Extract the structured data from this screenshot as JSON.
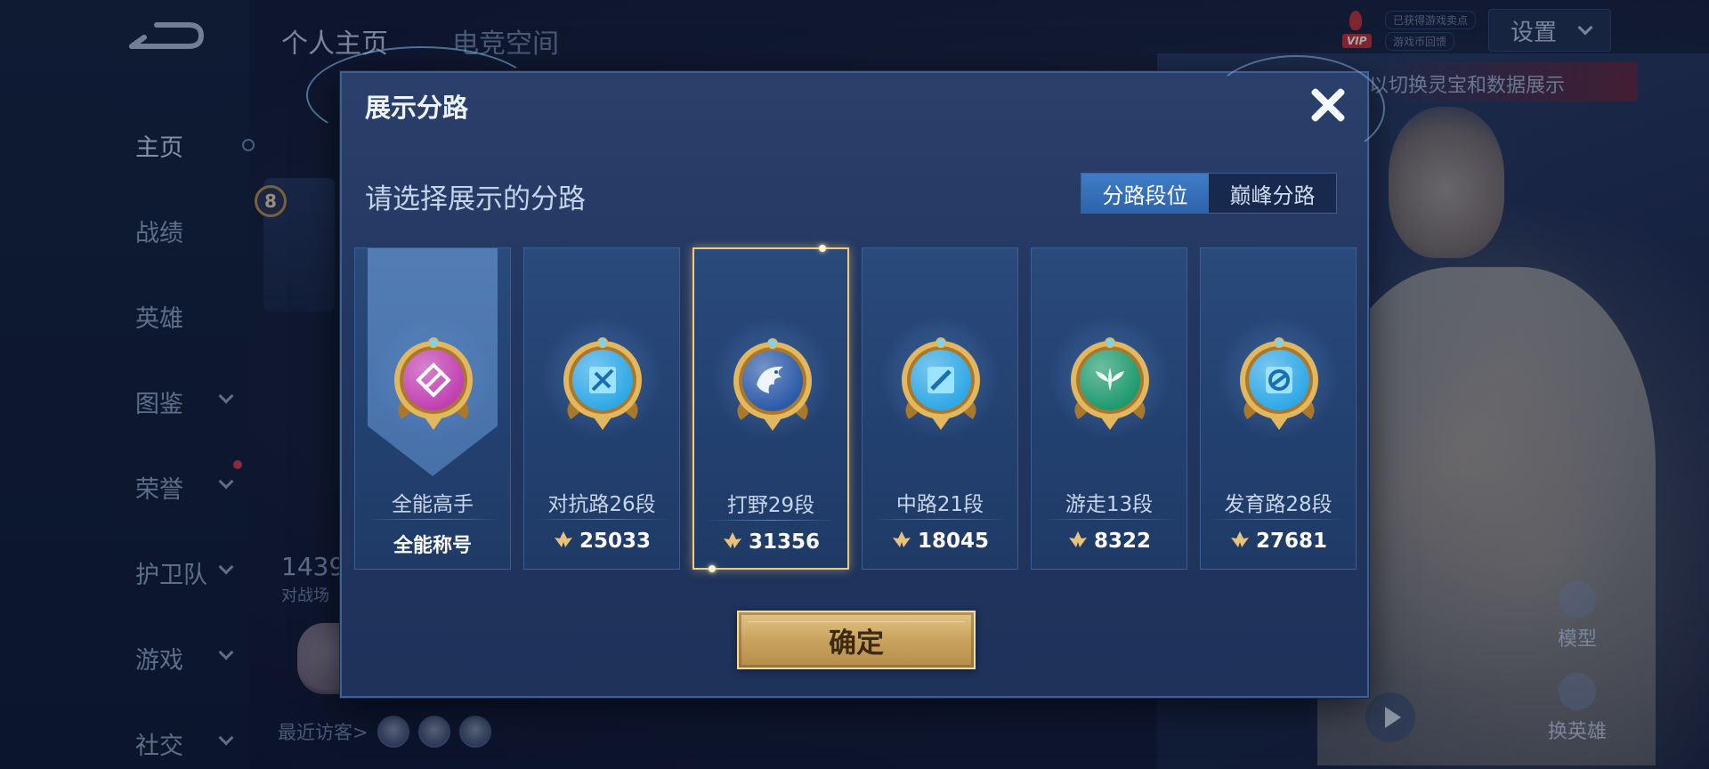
{
  "background": {
    "top_tabs": [
      "个人主页",
      "电竞空间"
    ],
    "nav_items": [
      {
        "label": "主页",
        "active": true,
        "has_chevron": false
      },
      {
        "label": "战绩",
        "active": false,
        "has_chevron": false
      },
      {
        "label": "英雄",
        "active": false,
        "has_chevron": false
      },
      {
        "label": "图鉴",
        "active": false,
        "has_chevron": true
      },
      {
        "label": "荣誉",
        "active": false,
        "has_chevron": true,
        "red_dot": true
      },
      {
        "label": "护卫队",
        "active": false,
        "has_chevron": true
      },
      {
        "label": "游戏",
        "active": false,
        "has_chevron": true
      },
      {
        "label": "社交",
        "active": false,
        "has_chevron": true
      }
    ],
    "vip": {
      "badge": "VIP",
      "line1": "已获得游戏卖点",
      "line2": "游戏币回馈"
    },
    "settings_label": "设置",
    "hint_text": "以切换灵宝和数据展示",
    "side_buttons": [
      "模型",
      "换英雄"
    ],
    "stats_number": "1439",
    "stats_sub": "对战场",
    "level": "8",
    "recent_visitors": "最近访客>"
  },
  "modal": {
    "title": "展示分路",
    "prompt": "请选择展示的分路",
    "toggle": [
      {
        "label": "分路段位",
        "active": true
      },
      {
        "label": "巅峰分路",
        "active": false
      }
    ],
    "cards": [
      {
        "lane": "全能高手",
        "value": "全能称号",
        "type": "title",
        "badge_icon": "all-round-badge-icon",
        "color": "#c13fb2"
      },
      {
        "lane": "对抗路26段",
        "value": "25033",
        "type": "score",
        "badge_icon": "clash-lane-badge-icon",
        "color": "#2fa8e6"
      },
      {
        "lane": "打野29段",
        "value": "31356",
        "type": "score",
        "badge_icon": "jungle-badge-icon",
        "color": "#2b5aa8",
        "selected": true
      },
      {
        "lane": "中路21段",
        "value": "18045",
        "type": "score",
        "badge_icon": "mid-lane-badge-icon",
        "color": "#2fa8e6"
      },
      {
        "lane": "游走13段",
        "value": "8322",
        "type": "score",
        "badge_icon": "roam-badge-icon",
        "color": "#1e9a6e"
      },
      {
        "lane": "发育路28段",
        "value": "27681",
        "type": "score",
        "badge_icon": "farm-lane-badge-icon",
        "color": "#2fa8e6"
      }
    ],
    "confirm_label": "确定"
  }
}
